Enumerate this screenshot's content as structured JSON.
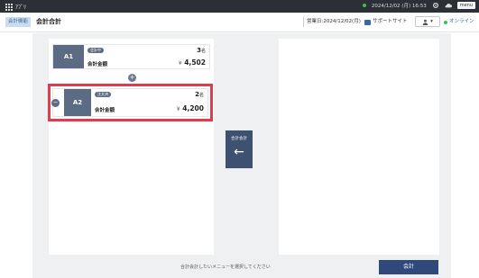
{
  "system": {
    "app_label": "ｱﾌﾟﾘ",
    "datetime": "2024/12/02 (月) 16:53",
    "menu_label": "menu"
  },
  "header": {
    "crumb": "会計機能",
    "title": "会計合計",
    "business_date": "営業日:2024/12/02(月)",
    "support": "サポートサイト",
    "status_icon": "person-icon",
    "online": "オンライン"
  },
  "cards": [
    {
      "table": "A1",
      "tag": "会計中",
      "count": "3",
      "count_unit": "名",
      "amount_label": "会計金額",
      "yen": "¥",
      "amount": "4,502"
    },
    {
      "table": "A2",
      "tag": "注文済",
      "count": "2",
      "count_unit": "名",
      "amount_label": "会計金額",
      "yen": "¥",
      "amount": "4,200"
    }
  ],
  "merge_button": {
    "label": "合計会計",
    "arrow": "←"
  },
  "footer": {
    "hint": "合計会計したいメニューを選択してください",
    "pay_button": "会計"
  },
  "colors": {
    "accent": "#3e5170",
    "highlight": "#e23b4e",
    "online": "#2d6fb3"
  }
}
